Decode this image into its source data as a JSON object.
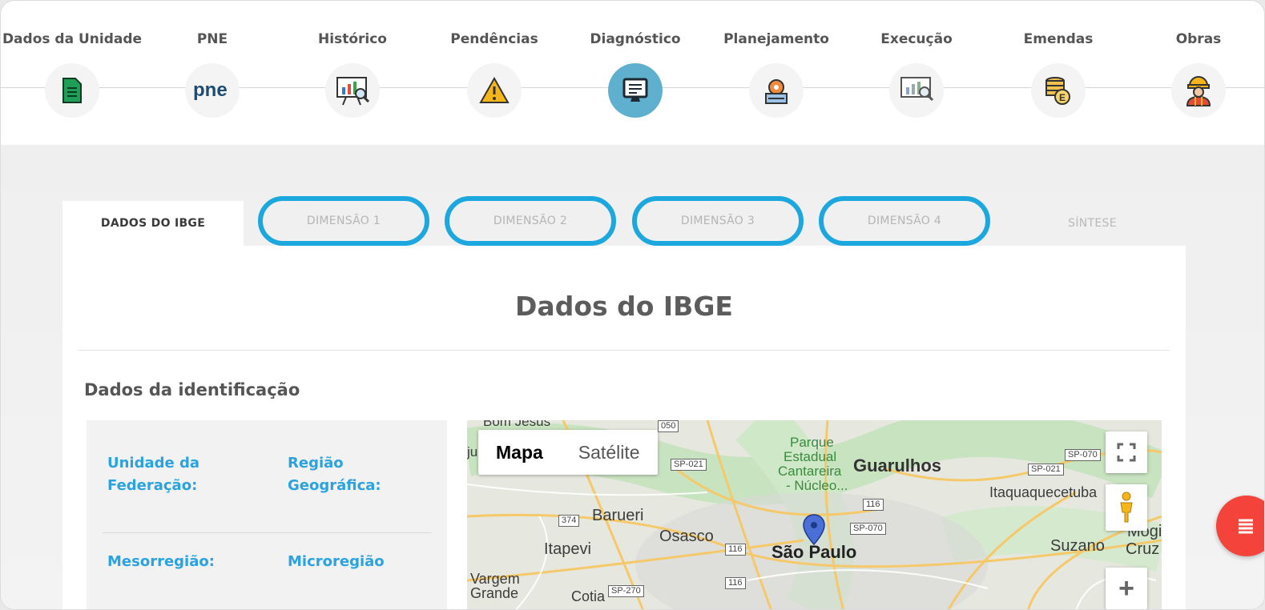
{
  "stepper": {
    "steps": [
      {
        "label": "Dados da Unidade",
        "icon": "document-icon"
      },
      {
        "label": "PNE",
        "icon": "pne-logo-icon"
      },
      {
        "label": "Histórico",
        "icon": "presentation-chart-icon"
      },
      {
        "label": "Pendências",
        "icon": "warning-icon"
      },
      {
        "label": "Diagnóstico",
        "icon": "monitor-checklist-icon",
        "active": true
      },
      {
        "label": "Planejamento",
        "icon": "planning-gear-icon"
      },
      {
        "label": "Execução",
        "icon": "presentation-search-icon"
      },
      {
        "label": "Emendas",
        "icon": "coins-icon"
      },
      {
        "label": "Obras",
        "icon": "worker-icon"
      }
    ]
  },
  "tabs": {
    "ibge": "DADOS DO IBGE",
    "dim1": "DIMENSÃO 1",
    "dim2": "DIMENSÃO 2",
    "dim3": "DIMENSÃO 3",
    "dim4": "DIMENSÃO 4",
    "sintese": "SÍNTESE"
  },
  "card": {
    "title": "Dados do IBGE",
    "section_title": "Dados da identificação",
    "fields": {
      "uf": "Unidade da Federação:",
      "regiao": "Região Geográfica:",
      "meso": "Mesorregião:",
      "micro": "Microregião"
    }
  },
  "map": {
    "type_map": "Mapa",
    "type_satellite": "Satélite",
    "places": {
      "bom_jesus": "Bom Jesus",
      "parque": "Parque",
      "estadual": "Estadual",
      "cantareira": "Cantareira",
      "nucleo": "- Núcleo...",
      "guarulhos": "Guarulhos",
      "itaquaquecetuba": "Itaquaquecetuba",
      "barueri": "Barueri",
      "osasco": "Osasco",
      "itapevi": "Itapevi",
      "sao_paulo": "São Paulo",
      "suzano": "Suzano",
      "mogi": "Mogi",
      "cruz": "Cruz",
      "vargem": "Vargem",
      "grande": "Grande",
      "cotia": "Cotia",
      "ju": "ju"
    },
    "shields": {
      "s050": "050",
      "sp021a": "SP-021",
      "sp070a": "SP-070",
      "sp021b": "SP-021",
      "s116a": "116",
      "sp070b": "SP-070",
      "s374": "374",
      "s116b": "116",
      "s116c": "116",
      "sp270": "SP-270"
    },
    "zoom_in": "+"
  },
  "colors": {
    "accent": "#1ca7de",
    "label_blue": "#2aa3de",
    "active_step": "#5fb0cf",
    "fab": "#f4433b"
  }
}
